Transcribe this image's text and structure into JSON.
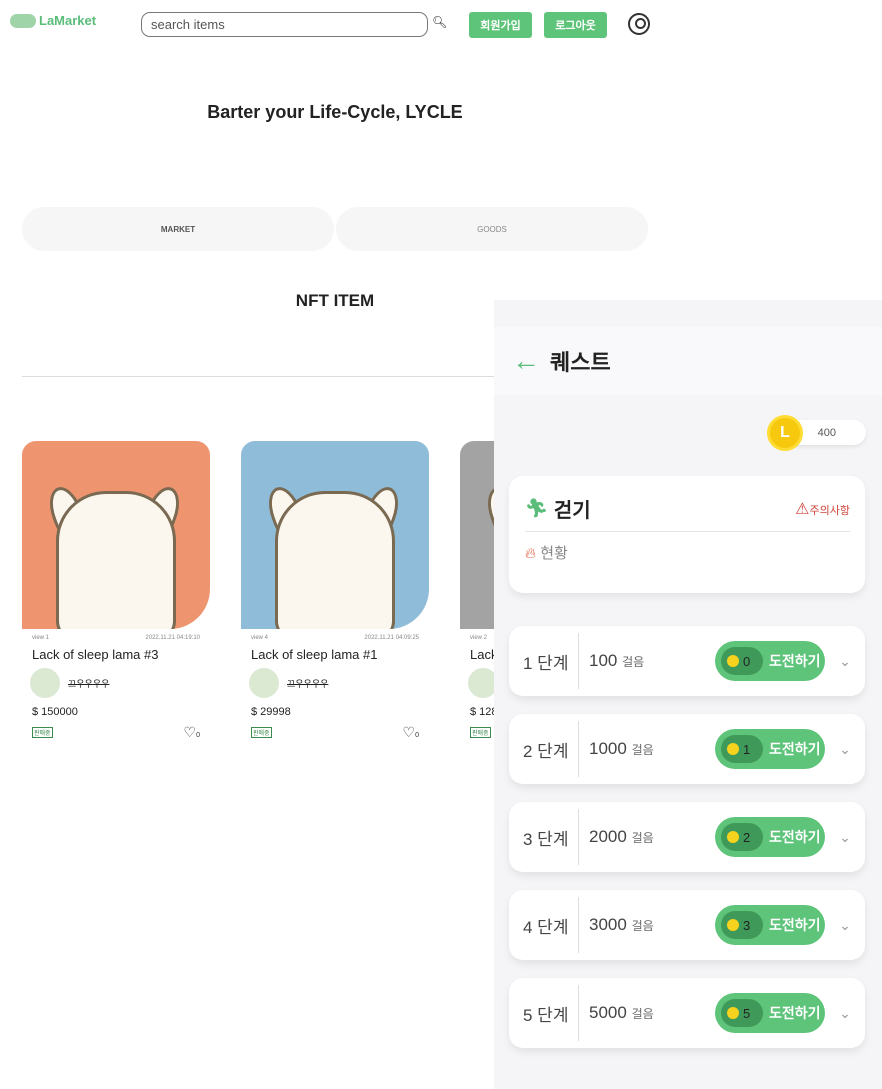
{
  "header": {
    "logo": "LaMarket",
    "search_placeholder": "search items",
    "signup": "회원가입",
    "logout": "로그아웃"
  },
  "tagline": "Barter your Life-Cycle, LYCLE",
  "tabs": [
    "MARKET",
    "GOODS"
  ],
  "section_title": "NFT ITEM",
  "items": [
    {
      "views": "view 1",
      "date": "2022.11.21 04:19:10",
      "title": "Lack of sleep lama #3",
      "seller": "끄우우우우",
      "price": "$ 150000",
      "status": "판매중",
      "likes": "0",
      "bg": "#ee9570"
    },
    {
      "views": "view 4",
      "date": "2022.11.21 04:09:25",
      "title": "Lack of sleep lama #1",
      "seller": "끄우우우우",
      "price": "$ 29998",
      "status": "판매중",
      "likes": "0",
      "bg": "#8fbcd8"
    },
    {
      "views": "view 2",
      "date": "",
      "title": "Lack",
      "seller": "",
      "price": "$ 128",
      "status": "판매중",
      "likes": "",
      "bg": "#a3a3a3"
    }
  ],
  "quest": {
    "title": "퀘스트",
    "balance": "400",
    "coin_letter": "L",
    "category": "걷기",
    "warning": "주의사항",
    "status": "현황",
    "steps": [
      {
        "level": "1 단계",
        "count": "100",
        "unit": "걸음",
        "coins": "0",
        "action": "도전하기"
      },
      {
        "level": "2 단계",
        "count": "1000",
        "unit": "걸음",
        "coins": "1",
        "action": "도전하기"
      },
      {
        "level": "3 단계",
        "count": "2000",
        "unit": "걸음",
        "coins": "2",
        "action": "도전하기"
      },
      {
        "level": "4 단계",
        "count": "3000",
        "unit": "걸음",
        "coins": "3",
        "action": "도전하기"
      },
      {
        "level": "5 단계",
        "count": "5000",
        "unit": "걸음",
        "coins": "5",
        "action": "도전하기"
      }
    ]
  }
}
